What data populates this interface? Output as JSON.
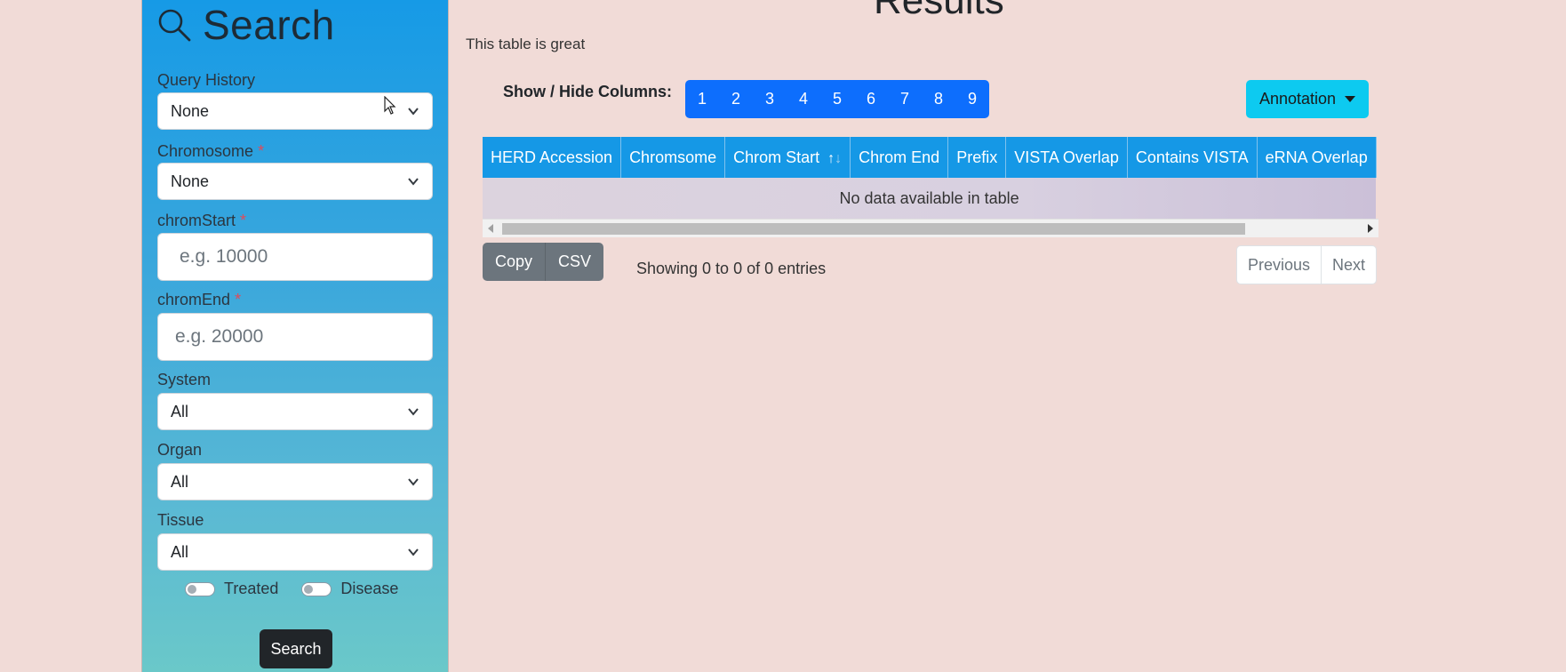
{
  "sidebar": {
    "title": "Search",
    "query_history": {
      "label": "Query History",
      "value": "None"
    },
    "chromosome": {
      "label": "Chromosome",
      "required": "*",
      "value": "None"
    },
    "chrom_start": {
      "label": "chromStart",
      "required": "*",
      "placeholder": "e.g. 10000"
    },
    "chrom_end": {
      "label": "chromEnd",
      "required": "*",
      "placeholder": "e.g. 20000"
    },
    "system": {
      "label": "System",
      "value": "All"
    },
    "organ": {
      "label": "Organ",
      "value": "All"
    },
    "tissue": {
      "label": "Tissue",
      "value": "All"
    },
    "toggles": {
      "treated": "Treated",
      "disease": "Disease"
    },
    "search_button": "Search"
  },
  "main": {
    "title": "Results",
    "subtitle": "This table is great",
    "show_hide_label": "Show / Hide Columns:",
    "column_buttons": [
      "1",
      "2",
      "3",
      "4",
      "5",
      "6",
      "7",
      "8",
      "9"
    ],
    "annotation_button": "Annotation",
    "table": {
      "headers": [
        "HERD Accession",
        "Chromsome",
        "Chrom Start",
        "Chrom End",
        "Prefix",
        "VISTA Overlap",
        "Contains VISTA",
        "eRNA Overlap"
      ],
      "sort_up": "↑",
      "sort_down": "↓",
      "empty_message": "No data available in table"
    },
    "export_buttons": {
      "copy": "Copy",
      "csv": "CSV"
    },
    "info": "Showing 0 to 0 of 0 entries",
    "pagination": {
      "previous": "Previous",
      "next": "Next"
    }
  },
  "colors": {
    "primary": "#0d6efd",
    "info": "#0dcaf0",
    "table_header": "#1598e6",
    "background": "#f1dbd7"
  }
}
